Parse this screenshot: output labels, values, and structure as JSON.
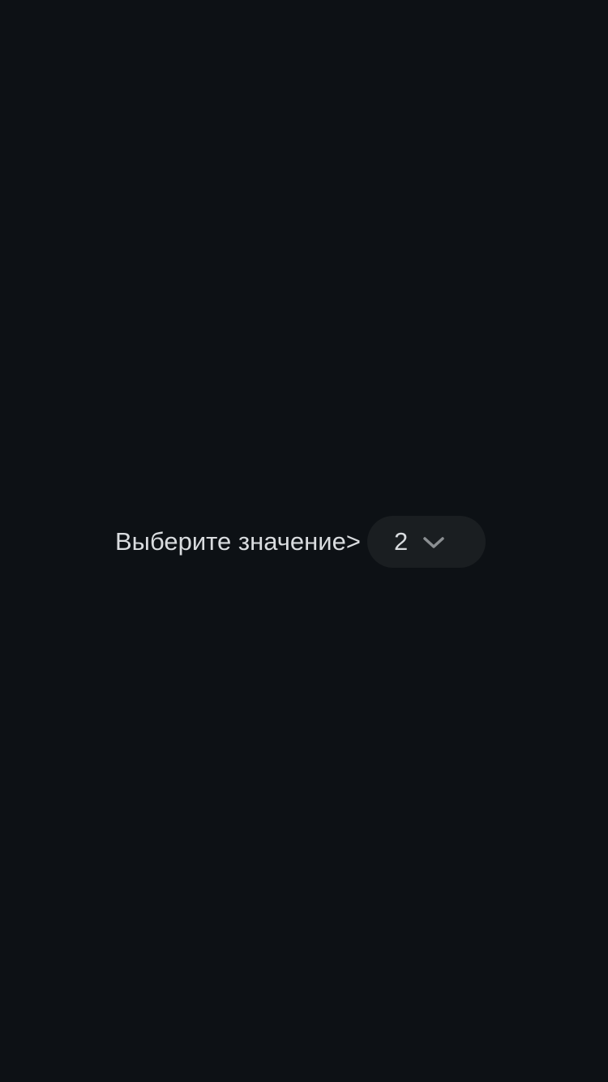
{
  "picker": {
    "label": "Выберите значение>",
    "selected_value": "2",
    "dropdown_icon": "chevron-down-icon"
  },
  "colors": {
    "background": "#0d1115",
    "select_background": "#1a1e21",
    "text": "#d9dcdf",
    "icon": "#8b8f92"
  }
}
